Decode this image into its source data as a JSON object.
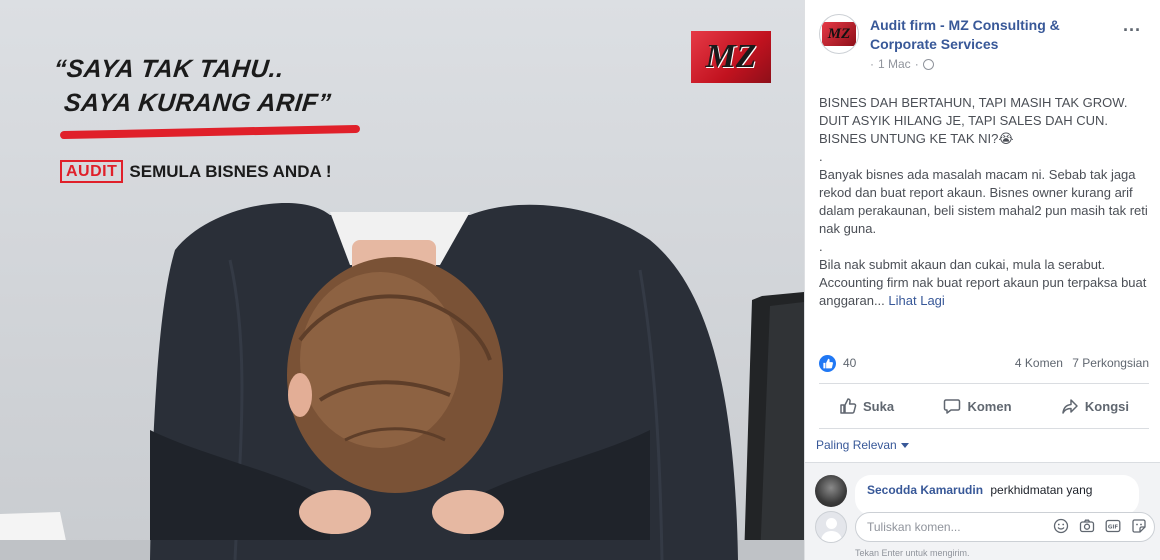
{
  "image": {
    "quote_line1": "“SAYA TAK TAHU..",
    "quote_line2": "SAYA KURANG ARIF”",
    "audit_label": "AUDIT",
    "audit_tagline": "SEMULA BISNES ANDA !",
    "logo_text": "MZ"
  },
  "post": {
    "page_name": "Audit firm - MZ Consulting & Corporate Services",
    "date": "1 Mac",
    "more_icon": "···",
    "body": [
      "BISNES DAH BERTAHUN, TAPI MASIH TAK GROW. DUIT ASYIK HILANG JE, TAPI SALES DAH CUN. BISNES UNTUNG KE TAK NI?😭",
      ".",
      "Banyak bisnes ada masalah macam ni. Sebab tak jaga rekod dan buat report akaun. Bisnes owner kurang arif dalam perakaunan, beli sistem mahal2 pun masih tak reti nak guna.",
      ".",
      "Bila nak submit akaun dan cukai, mula la serabut. Accounting firm nak buat report akaun pun terpaksa buat anggaran..."
    ],
    "see_more": "Lihat Lagi",
    "likes": "40",
    "comments_count": "4 Komen",
    "shares_count": "7 Perkongsian",
    "actions": {
      "like": "Suka",
      "comment": "Komen",
      "share": "Kongsi"
    },
    "sort_label": "Paling Relevan",
    "comment": {
      "author": "Secodda Kamarudin",
      "text": "perkhidmatan yang"
    },
    "reply_placeholder": "Tuliskan komen...",
    "enter_hint": "Tekan Enter untuk mengirim."
  },
  "colors": {
    "link": "#385898",
    "accent_red": "#e0202a",
    "like_blue": "#2078f4",
    "muted": "#606770"
  }
}
